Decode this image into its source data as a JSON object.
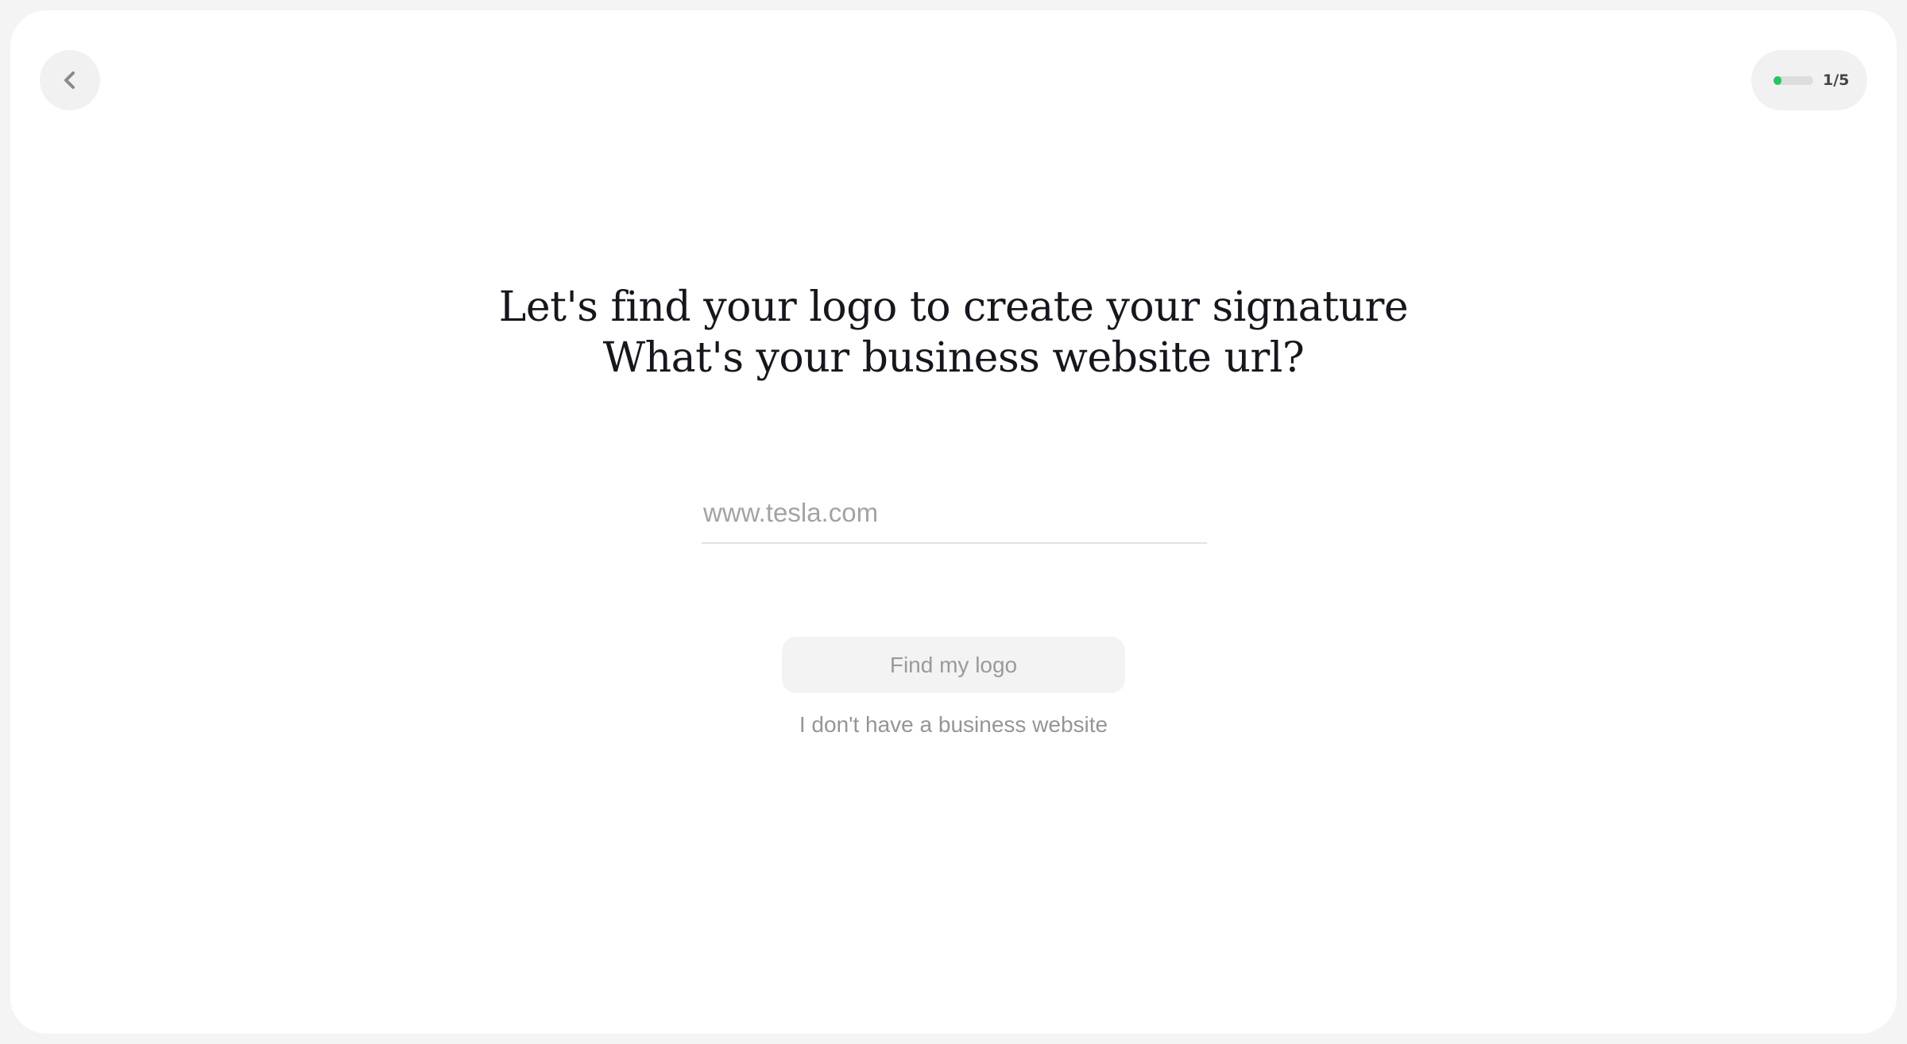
{
  "header": {
    "back_icon": "chevron-left-icon",
    "progress": {
      "current": 1,
      "total": 5,
      "label": "1/5",
      "fraction": 0.2,
      "color": "#22c55e"
    }
  },
  "main": {
    "heading_line1": "Let's find your logo to create your signature",
    "heading_line2": "What's your business website url?",
    "url_input": {
      "value": "",
      "placeholder": "www.tesla.com"
    },
    "find_button_label": "Find my logo",
    "no_website_label": "I don't have a business website"
  }
}
